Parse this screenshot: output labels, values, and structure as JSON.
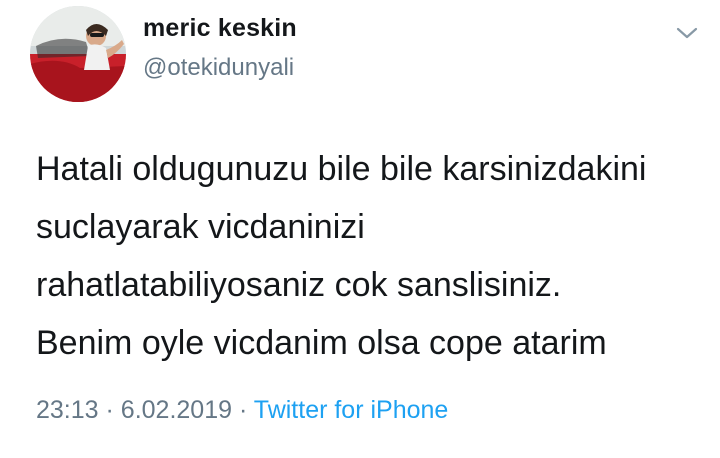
{
  "author": {
    "display_name": "meric keskin",
    "handle": "@otekidunyali"
  },
  "menu": {
    "icon": "chevron-down-icon"
  },
  "tweet": {
    "lines": [
      "Hatali oldugunuzu bile bile karsinizdakini",
      "suclayarak vicdaninizi",
      "rahatlatabiliyosaniz cok sanslisiniz.",
      "Benim oyle vicdanim olsa cope atarim"
    ],
    "time": "23:13",
    "separator": "·",
    "date": "6.02.2019",
    "source": "Twitter for iPhone"
  },
  "colors": {
    "text": "#14171a",
    "secondary": "#657786",
    "link": "#1da1f2"
  }
}
